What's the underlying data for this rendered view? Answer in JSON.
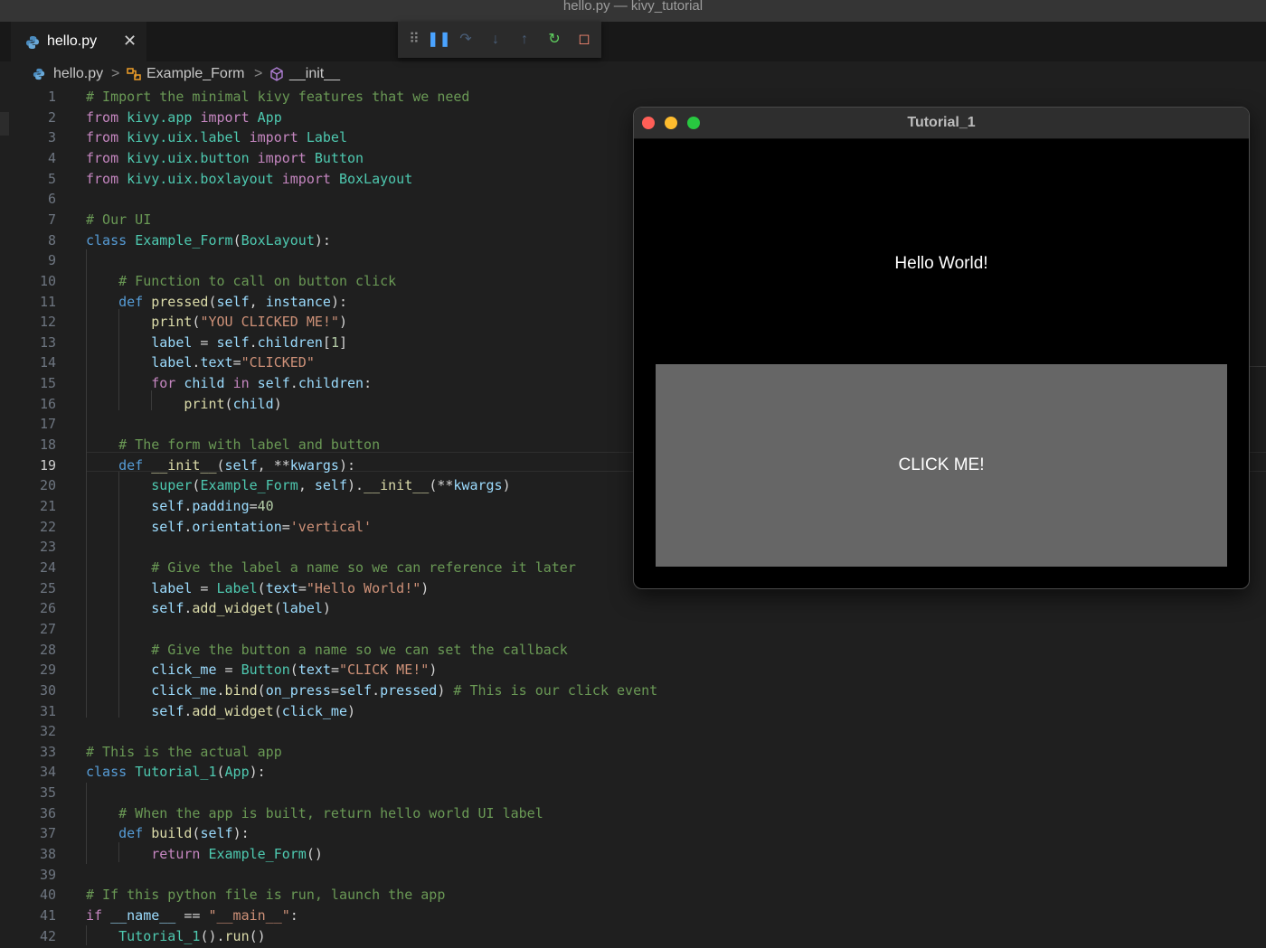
{
  "window": {
    "title": "hello.py — kivy_tutorial"
  },
  "tab": {
    "filename": "hello.py",
    "close_label": "✕"
  },
  "debug_toolbar": {
    "buttons": [
      {
        "name": "drag-handle-icon",
        "glyph": "⠿",
        "color": "#8a8a8a"
      },
      {
        "name": "pause-icon",
        "glyph": "❚❚",
        "color": "#4aa3ff"
      },
      {
        "name": "step-over-icon",
        "glyph": "↷",
        "color": "#4a5f7a"
      },
      {
        "name": "step-into-icon",
        "glyph": "↓",
        "color": "#4a5f7a"
      },
      {
        "name": "step-out-icon",
        "glyph": "↑",
        "color": "#4a5f7a"
      },
      {
        "name": "restart-icon",
        "glyph": "↻",
        "color": "#5fcf5f"
      },
      {
        "name": "stop-icon",
        "glyph": "◻",
        "color": "#f48771"
      }
    ]
  },
  "breadcrumb": {
    "file": "hello.py",
    "class": "Example_Form",
    "method": "__init__",
    "separator": ">"
  },
  "editor": {
    "active_line": 19,
    "lines": [
      {
        "n": "1",
        "t": [
          [
            "c-com",
            "# Import the minimal kivy features that we need"
          ]
        ]
      },
      {
        "n": "2",
        "t": [
          [
            "c-kw",
            "from"
          ],
          [
            "c-op",
            " "
          ],
          [
            "c-cls",
            "kivy.app"
          ],
          [
            "c-op",
            " "
          ],
          [
            "c-kw",
            "import"
          ],
          [
            "c-op",
            " "
          ],
          [
            "c-cls",
            "App"
          ]
        ]
      },
      {
        "n": "3",
        "t": [
          [
            "c-kw",
            "from"
          ],
          [
            "c-op",
            " "
          ],
          [
            "c-cls",
            "kivy.uix.label"
          ],
          [
            "c-op",
            " "
          ],
          [
            "c-kw",
            "import"
          ],
          [
            "c-op",
            " "
          ],
          [
            "c-cls",
            "Label"
          ]
        ]
      },
      {
        "n": "4",
        "t": [
          [
            "c-kw",
            "from"
          ],
          [
            "c-op",
            " "
          ],
          [
            "c-cls",
            "kivy.uix.button"
          ],
          [
            "c-op",
            " "
          ],
          [
            "c-kw",
            "import"
          ],
          [
            "c-op",
            " "
          ],
          [
            "c-cls",
            "Button"
          ]
        ]
      },
      {
        "n": "5",
        "t": [
          [
            "c-kw",
            "from"
          ],
          [
            "c-op",
            " "
          ],
          [
            "c-cls",
            "kivy.uix.boxlayout"
          ],
          [
            "c-op",
            " "
          ],
          [
            "c-kw",
            "import"
          ],
          [
            "c-op",
            " "
          ],
          [
            "c-cls",
            "BoxLayout"
          ]
        ]
      },
      {
        "n": "6",
        "t": []
      },
      {
        "n": "7",
        "t": [
          [
            "c-com",
            "# Our UI"
          ]
        ]
      },
      {
        "n": "8",
        "t": [
          [
            "c-def",
            "class"
          ],
          [
            "c-op",
            " "
          ],
          [
            "c-cls",
            "Example_Form"
          ],
          [
            "c-op",
            "("
          ],
          [
            "c-cls",
            "BoxLayout"
          ],
          [
            "c-op",
            "):"
          ]
        ]
      },
      {
        "n": "9",
        "t": []
      },
      {
        "n": "10",
        "t": [
          [
            "c-op",
            "    "
          ],
          [
            "c-com",
            "# Function to call on button click"
          ]
        ]
      },
      {
        "n": "11",
        "t": [
          [
            "c-op",
            "    "
          ],
          [
            "c-def",
            "def"
          ],
          [
            "c-op",
            " "
          ],
          [
            "c-fn",
            "pressed"
          ],
          [
            "c-op",
            "("
          ],
          [
            "c-var",
            "self"
          ],
          [
            "c-op",
            ", "
          ],
          [
            "c-var",
            "instance"
          ],
          [
            "c-op",
            "):"
          ]
        ]
      },
      {
        "n": "12",
        "t": [
          [
            "c-op",
            "        "
          ],
          [
            "c-fn",
            "print"
          ],
          [
            "c-op",
            "("
          ],
          [
            "c-str",
            "\"YOU CLICKED ME!\""
          ],
          [
            "c-op",
            ")"
          ]
        ]
      },
      {
        "n": "13",
        "t": [
          [
            "c-op",
            "        "
          ],
          [
            "c-var",
            "label"
          ],
          [
            "c-op",
            " = "
          ],
          [
            "c-var",
            "self"
          ],
          [
            "c-op",
            "."
          ],
          [
            "c-var",
            "children"
          ],
          [
            "c-op",
            "["
          ],
          [
            "c-num",
            "1"
          ],
          [
            "c-op",
            "]"
          ]
        ]
      },
      {
        "n": "14",
        "t": [
          [
            "c-op",
            "        "
          ],
          [
            "c-var",
            "label"
          ],
          [
            "c-op",
            "."
          ],
          [
            "c-var",
            "text"
          ],
          [
            "c-op",
            "="
          ],
          [
            "c-str",
            "\"CLICKED\""
          ]
        ]
      },
      {
        "n": "15",
        "t": [
          [
            "c-op",
            "        "
          ],
          [
            "c-kw",
            "for"
          ],
          [
            "c-op",
            " "
          ],
          [
            "c-var",
            "child"
          ],
          [
            "c-op",
            " "
          ],
          [
            "c-kw",
            "in"
          ],
          [
            "c-op",
            " "
          ],
          [
            "c-var",
            "self"
          ],
          [
            "c-op",
            "."
          ],
          [
            "c-var",
            "children"
          ],
          [
            "c-op",
            ":"
          ]
        ]
      },
      {
        "n": "16",
        "t": [
          [
            "c-op",
            "            "
          ],
          [
            "c-fn",
            "print"
          ],
          [
            "c-op",
            "("
          ],
          [
            "c-var",
            "child"
          ],
          [
            "c-op",
            ")"
          ]
        ]
      },
      {
        "n": "17",
        "t": []
      },
      {
        "n": "18",
        "t": [
          [
            "c-op",
            "    "
          ],
          [
            "c-com",
            "# The form with label and button"
          ]
        ]
      },
      {
        "n": "19",
        "t": [
          [
            "c-op",
            "    "
          ],
          [
            "c-def",
            "def"
          ],
          [
            "c-op",
            " "
          ],
          [
            "c-fn",
            "__init__"
          ],
          [
            "c-op",
            "("
          ],
          [
            "c-var",
            "self"
          ],
          [
            "c-op",
            ", "
          ],
          [
            "c-op",
            "**"
          ],
          [
            "c-var",
            "kwargs"
          ],
          [
            "c-op",
            "):"
          ]
        ]
      },
      {
        "n": "20",
        "t": [
          [
            "c-op",
            "        "
          ],
          [
            "c-cls",
            "super"
          ],
          [
            "c-op",
            "("
          ],
          [
            "c-cls",
            "Example_Form"
          ],
          [
            "c-op",
            ", "
          ],
          [
            "c-var",
            "self"
          ],
          [
            "c-op",
            ")."
          ],
          [
            "c-fn",
            "__init__"
          ],
          [
            "c-op",
            "(**"
          ],
          [
            "c-var",
            "kwargs"
          ],
          [
            "c-op",
            ")"
          ]
        ]
      },
      {
        "n": "21",
        "t": [
          [
            "c-op",
            "        "
          ],
          [
            "c-var",
            "self"
          ],
          [
            "c-op",
            "."
          ],
          [
            "c-var",
            "padding"
          ],
          [
            "c-op",
            "="
          ],
          [
            "c-num",
            "40"
          ]
        ]
      },
      {
        "n": "22",
        "t": [
          [
            "c-op",
            "        "
          ],
          [
            "c-var",
            "self"
          ],
          [
            "c-op",
            "."
          ],
          [
            "c-var",
            "orientation"
          ],
          [
            "c-op",
            "="
          ],
          [
            "c-str",
            "'vertical'"
          ]
        ]
      },
      {
        "n": "23",
        "t": []
      },
      {
        "n": "24",
        "t": [
          [
            "c-op",
            "        "
          ],
          [
            "c-com",
            "# Give the label a name so we can reference it later"
          ]
        ]
      },
      {
        "n": "25",
        "t": [
          [
            "c-op",
            "        "
          ],
          [
            "c-var",
            "label"
          ],
          [
            "c-op",
            " = "
          ],
          [
            "c-cls",
            "Label"
          ],
          [
            "c-op",
            "("
          ],
          [
            "c-var",
            "text"
          ],
          [
            "c-op",
            "="
          ],
          [
            "c-str",
            "\"Hello World!\""
          ],
          [
            "c-op",
            ")"
          ]
        ]
      },
      {
        "n": "26",
        "t": [
          [
            "c-op",
            "        "
          ],
          [
            "c-var",
            "self"
          ],
          [
            "c-op",
            "."
          ],
          [
            "c-fn",
            "add_widget"
          ],
          [
            "c-op",
            "("
          ],
          [
            "c-var",
            "label"
          ],
          [
            "c-op",
            ")"
          ]
        ]
      },
      {
        "n": "27",
        "t": []
      },
      {
        "n": "28",
        "t": [
          [
            "c-op",
            "        "
          ],
          [
            "c-com",
            "# Give the button a name so we can set the callback"
          ]
        ]
      },
      {
        "n": "29",
        "t": [
          [
            "c-op",
            "        "
          ],
          [
            "c-var",
            "click_me"
          ],
          [
            "c-op",
            " = "
          ],
          [
            "c-cls",
            "Button"
          ],
          [
            "c-op",
            "("
          ],
          [
            "c-var",
            "text"
          ],
          [
            "c-op",
            "="
          ],
          [
            "c-str",
            "\"CLICK ME!\""
          ],
          [
            "c-op",
            ")"
          ]
        ]
      },
      {
        "n": "30",
        "t": [
          [
            "c-op",
            "        "
          ],
          [
            "c-var",
            "click_me"
          ],
          [
            "c-op",
            "."
          ],
          [
            "c-fn",
            "bind"
          ],
          [
            "c-op",
            "("
          ],
          [
            "c-var",
            "on_press"
          ],
          [
            "c-op",
            "="
          ],
          [
            "c-var",
            "self"
          ],
          [
            "c-op",
            "."
          ],
          [
            "c-var",
            "pressed"
          ],
          [
            "c-op",
            ") "
          ],
          [
            "c-com",
            "# This is our click event"
          ]
        ]
      },
      {
        "n": "31",
        "t": [
          [
            "c-op",
            "        "
          ],
          [
            "c-var",
            "self"
          ],
          [
            "c-op",
            "."
          ],
          [
            "c-fn",
            "add_widget"
          ],
          [
            "c-op",
            "("
          ],
          [
            "c-var",
            "click_me"
          ],
          [
            "c-op",
            ")"
          ]
        ]
      },
      {
        "n": "32",
        "t": []
      },
      {
        "n": "33",
        "t": [
          [
            "c-com",
            "# This is the actual app"
          ]
        ]
      },
      {
        "n": "34",
        "t": [
          [
            "c-def",
            "class"
          ],
          [
            "c-op",
            " "
          ],
          [
            "c-cls",
            "Tutorial_1"
          ],
          [
            "c-op",
            "("
          ],
          [
            "c-cls",
            "App"
          ],
          [
            "c-op",
            "):"
          ]
        ]
      },
      {
        "n": "35",
        "t": []
      },
      {
        "n": "36",
        "t": [
          [
            "c-op",
            "    "
          ],
          [
            "c-com",
            "# When the app is built, return hello world UI label"
          ]
        ]
      },
      {
        "n": "37",
        "t": [
          [
            "c-op",
            "    "
          ],
          [
            "c-def",
            "def"
          ],
          [
            "c-op",
            " "
          ],
          [
            "c-fn",
            "build"
          ],
          [
            "c-op",
            "("
          ],
          [
            "c-var",
            "self"
          ],
          [
            "c-op",
            "):"
          ]
        ]
      },
      {
        "n": "38",
        "t": [
          [
            "c-op",
            "        "
          ],
          [
            "c-kw",
            "return"
          ],
          [
            "c-op",
            " "
          ],
          [
            "c-cls",
            "Example_Form"
          ],
          [
            "c-op",
            "()"
          ]
        ]
      },
      {
        "n": "39",
        "t": []
      },
      {
        "n": "40",
        "t": [
          [
            "c-com",
            "# If this python file is run, launch the app"
          ]
        ]
      },
      {
        "n": "41",
        "t": [
          [
            "c-kw",
            "if"
          ],
          [
            "c-op",
            " "
          ],
          [
            "c-var",
            "__name__"
          ],
          [
            "c-op",
            " == "
          ],
          [
            "c-str",
            "\"__main__\""
          ],
          [
            "c-op",
            ":"
          ]
        ]
      },
      {
        "n": "42",
        "t": [
          [
            "c-op",
            "    "
          ],
          [
            "c-cls",
            "Tutorial_1"
          ],
          [
            "c-op",
            "()."
          ],
          [
            "c-fn",
            "run"
          ],
          [
            "c-op",
            "()"
          ]
        ]
      }
    ]
  },
  "kivy_window": {
    "title": "Tutorial_1",
    "label_text": "Hello World!",
    "button_text": "CLICK ME!",
    "traffic_lights": [
      "#ff5f57",
      "#febc2e",
      "#28c840"
    ]
  }
}
